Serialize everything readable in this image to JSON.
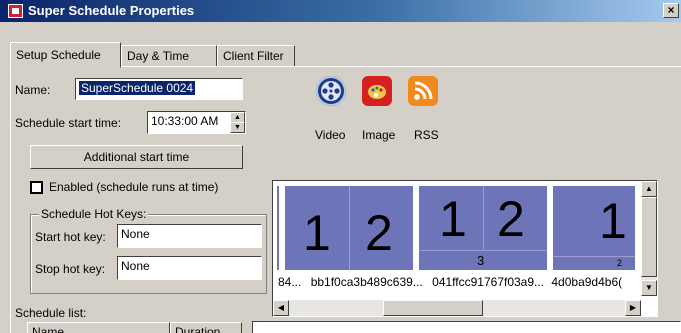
{
  "window": {
    "title": "Super Schedule Properties",
    "close": "×"
  },
  "tabs": [
    {
      "label": "Setup Schedule"
    },
    {
      "label": "Day & Time"
    },
    {
      "label": "Client Filter"
    }
  ],
  "form": {
    "name_label": "Name:",
    "name_value": "SuperSchedule 0024",
    "start_label": "Schedule start time:",
    "start_value": "10:33:00 AM",
    "additional_button": "Additional start time",
    "enabled_label": "Enabled (schedule runs at time)",
    "enabled_checked": false
  },
  "hotkeys": {
    "legend": "Schedule Hot Keys:",
    "start_label": "Start hot key:",
    "start_value": "None",
    "stop_label": "Stop hot key:",
    "stop_value": "None"
  },
  "media": [
    {
      "label": "Video",
      "icon": "video-reel-icon",
      "color": "#1e3a8a"
    },
    {
      "label": "Image",
      "icon": "palette-icon",
      "color": "#d32020"
    },
    {
      "label": "RSS",
      "icon": "rss-icon",
      "color": "#f08a1c"
    }
  ],
  "preview": {
    "thumbs": [
      {
        "label": "1 2"
      },
      {
        "label": "1 2 3"
      },
      {
        "label": "1 2"
      }
    ],
    "ids": [
      "84...",
      "bb1f0ca3b489c639...",
      "041ffcc91767f03a9...",
      "4d0ba9d4b6("
    ]
  },
  "schedule_list": {
    "label": "Schedule list:",
    "columns": [
      "Name",
      "Duration"
    ]
  }
}
